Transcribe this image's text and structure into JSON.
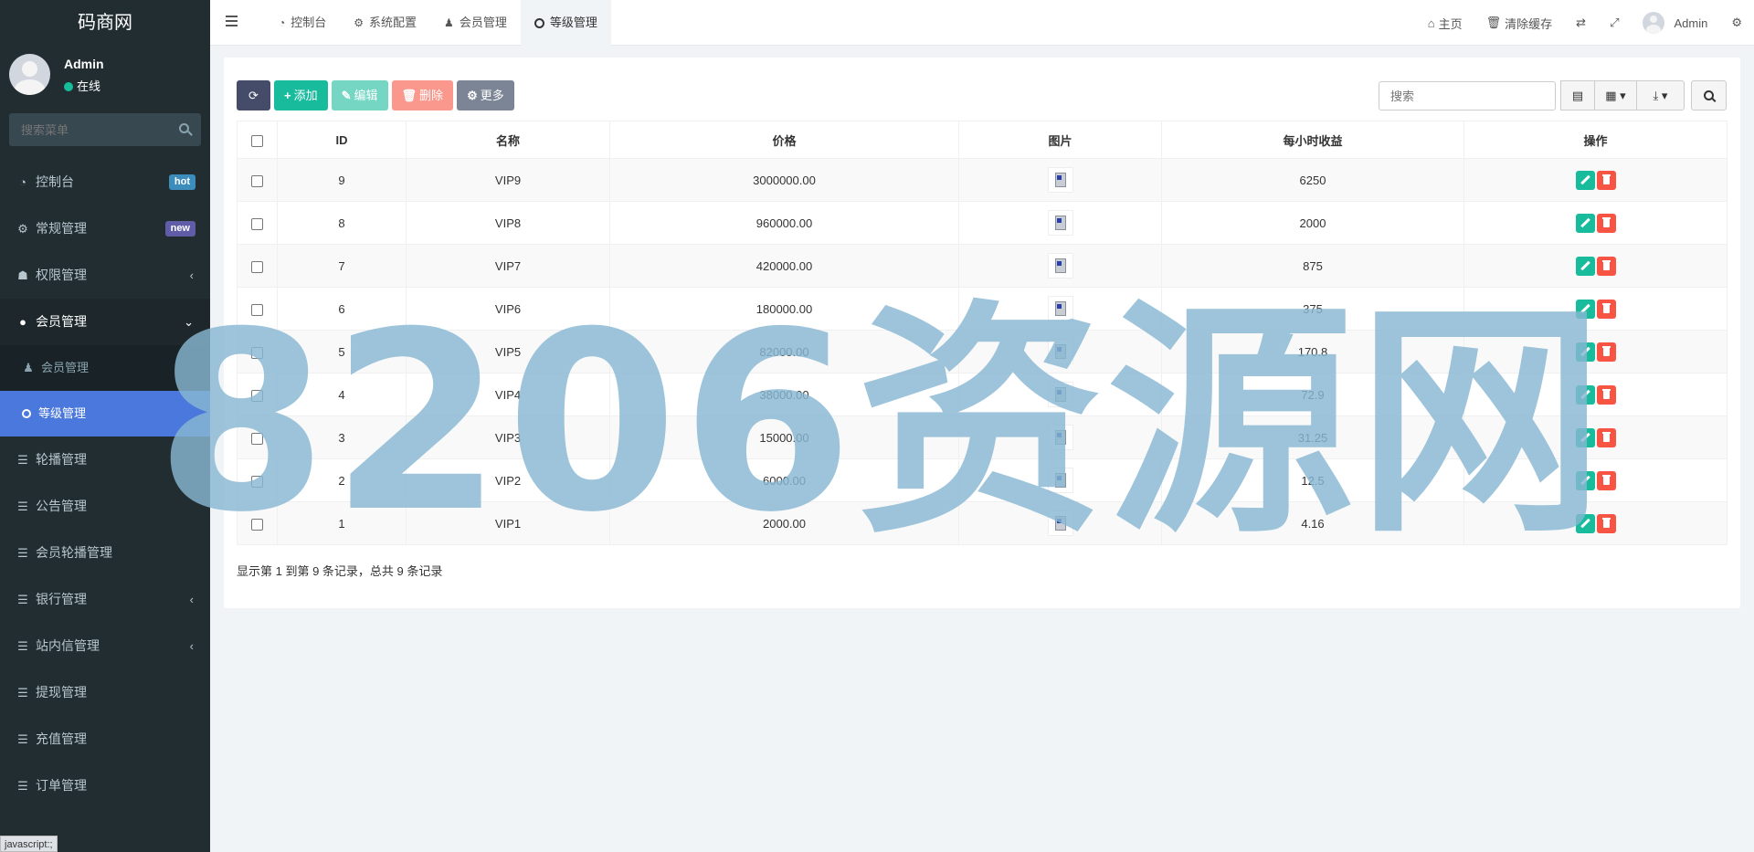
{
  "sidebar": {
    "logo": "码商网",
    "user_name": "Admin",
    "user_status": "在线",
    "search_placeholder": "搜索菜单",
    "items": [
      {
        "label": "控制台",
        "badge": "hot"
      },
      {
        "label": "常规管理",
        "badge": "new"
      },
      {
        "label": "权限管理"
      },
      {
        "label": "会员管理"
      },
      {
        "label": "会员管理"
      },
      {
        "label": "等级管理"
      },
      {
        "label": "轮播管理"
      },
      {
        "label": "公告管理"
      },
      {
        "label": "会员轮播管理"
      },
      {
        "label": "银行管理"
      },
      {
        "label": "站内信管理"
      },
      {
        "label": "提现管理"
      },
      {
        "label": "充值管理"
      },
      {
        "label": "订单管理"
      }
    ],
    "status_url": "javascript:;"
  },
  "header": {
    "tabs": [
      "控制台",
      "系统配置",
      "会员管理",
      "等级管理"
    ],
    "right": {
      "home": "主页",
      "clear_cache": "清除缓存",
      "user": "Admin"
    }
  },
  "toolbar": {
    "add": "添加",
    "edit": "编辑",
    "delete": "删除",
    "more": "更多",
    "search_placeholder": "搜索"
  },
  "table": {
    "columns": [
      "ID",
      "名称",
      "价格",
      "图片",
      "每小时收益",
      "操作"
    ],
    "rows": [
      {
        "id": "9",
        "name": "VIP9",
        "price": "3000000.00",
        "income": "6250"
      },
      {
        "id": "8",
        "name": "VIP8",
        "price": "960000.00",
        "income": "2000"
      },
      {
        "id": "7",
        "name": "VIP7",
        "price": "420000.00",
        "income": "875"
      },
      {
        "id": "6",
        "name": "VIP6",
        "price": "180000.00",
        "income": "375"
      },
      {
        "id": "5",
        "name": "VIP5",
        "price": "82000.00",
        "income": "170.8"
      },
      {
        "id": "4",
        "name": "VIP4",
        "price": "38000.00",
        "income": "72.9"
      },
      {
        "id": "3",
        "name": "VIP3",
        "price": "15000.00",
        "income": "31.25"
      },
      {
        "id": "2",
        "name": "VIP2",
        "price": "6000.00",
        "income": "12.5"
      },
      {
        "id": "1",
        "name": "VIP1",
        "price": "2000.00",
        "income": "4.16"
      }
    ]
  },
  "pager": "显示第 1 到第 9 条记录，总共 9 条记录",
  "watermark": "8206资源网",
  "colors": {
    "sidebar": "#222d32",
    "accent": "#4a78dd",
    "success": "#18bc9c",
    "danger": "#f75444"
  }
}
